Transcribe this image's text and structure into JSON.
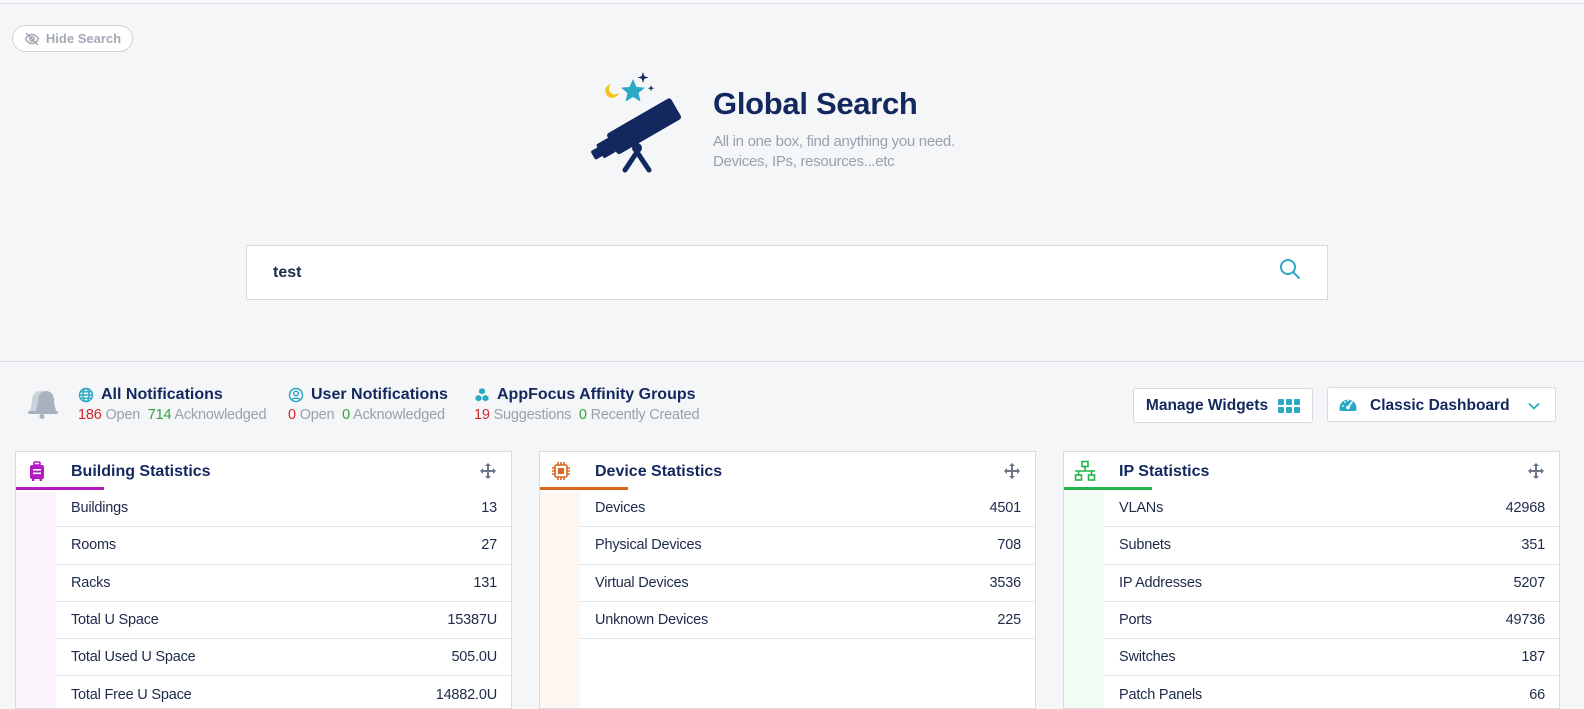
{
  "hide_search": {
    "label": "Hide Search"
  },
  "hero": {
    "title": "Global Search",
    "subtitle_line1": "All in one box, find anything you need.",
    "subtitle_line2": "Devices, IPs, resources...etc"
  },
  "search": {
    "value": "test",
    "placeholder": ""
  },
  "notifications": [
    {
      "title": "All Notifications",
      "count1": "186",
      "label1": "Open",
      "count2": "714",
      "label2": "Acknowledged"
    },
    {
      "title": "User Notifications",
      "count1": "0",
      "label1": "Open",
      "count2": "0",
      "label2": "Acknowledged"
    },
    {
      "title": "AppFocus Affinity Groups",
      "count1": "19",
      "label1": "Suggestions",
      "count2": "0",
      "label2": "Recently Created"
    }
  ],
  "toolbar": {
    "manage_widgets": "Manage Widgets",
    "dashboard": "Classic Dashboard"
  },
  "cards": [
    {
      "title": "Building Statistics",
      "accent": "#b51bc0",
      "strip": "#fbf3fc",
      "rows": [
        {
          "label": "Buildings",
          "value": "13"
        },
        {
          "label": "Rooms",
          "value": "27"
        },
        {
          "label": "Racks",
          "value": "131"
        },
        {
          "label": "Total U Space",
          "value": "15387U"
        },
        {
          "label": "Total Used U Space",
          "value": "505.0U"
        },
        {
          "label": "Total Free U Space",
          "value": "14882.0U"
        }
      ]
    },
    {
      "title": "Device Statistics",
      "accent": "#d9661f",
      "strip": "#fdf6f1",
      "rows": [
        {
          "label": "Devices",
          "value": "4501"
        },
        {
          "label": "Physical Devices",
          "value": "708"
        },
        {
          "label": "Virtual Devices",
          "value": "3536"
        },
        {
          "label": "Unknown Devices",
          "value": "225"
        }
      ]
    },
    {
      "title": "IP Statistics",
      "accent": "#1fb54a",
      "strip": "#f2fbf4",
      "rows": [
        {
          "label": "VLANs",
          "value": "42968"
        },
        {
          "label": "Subnets",
          "value": "351"
        },
        {
          "label": "IP Addresses",
          "value": "5207"
        },
        {
          "label": "Ports",
          "value": "49736"
        },
        {
          "label": "Switches",
          "value": "187"
        },
        {
          "label": "Patch Panels",
          "value": "66"
        }
      ]
    }
  ],
  "colors": {
    "navy": "#13285e",
    "teal": "#2aa9c4",
    "red": "#d1262b",
    "green": "#2aa63a"
  },
  "icons": [
    "eye-off-icon",
    "telescope-logo",
    "search-icon",
    "bell-icon",
    "globe-icon",
    "user-circle-icon",
    "cubes-icon",
    "grid-icon",
    "gauge-icon",
    "chevron-down-icon",
    "suitcase-icon",
    "chip-icon",
    "network-icon",
    "move-icon"
  ]
}
